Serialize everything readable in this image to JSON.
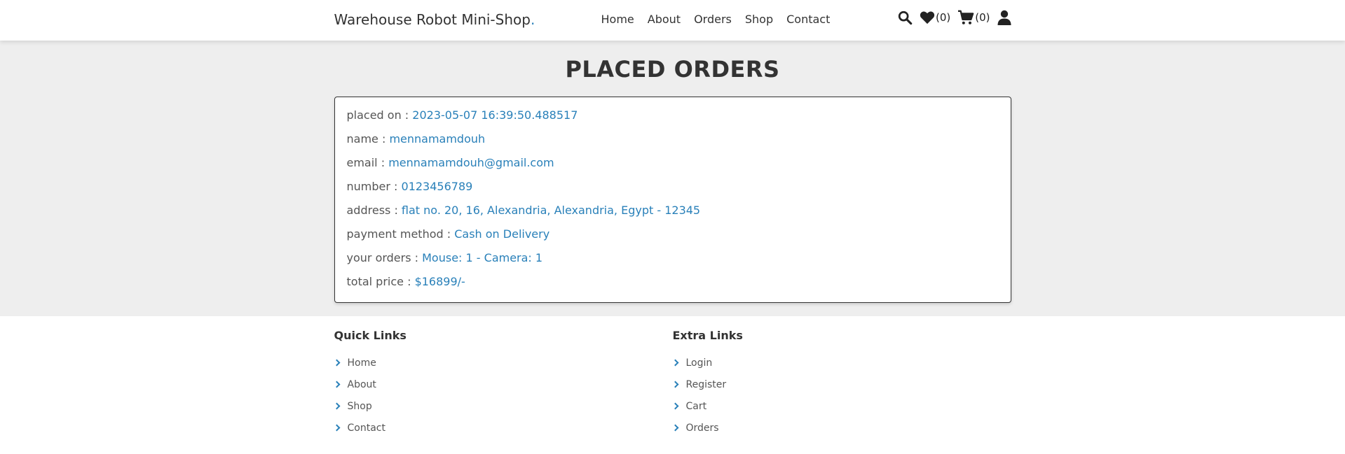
{
  "header": {
    "logo": "Warehouse Robot Mini-Shop",
    "logo_dot": ".",
    "nav": [
      {
        "label": "Home"
      },
      {
        "label": "About"
      },
      {
        "label": "Orders"
      },
      {
        "label": "Shop"
      },
      {
        "label": "Contact"
      }
    ],
    "wishlist_count": "(0)",
    "cart_count": "(0)",
    "icons": [
      "search-icon",
      "heart-icon",
      "cart-icon",
      "user-icon"
    ]
  },
  "main": {
    "title": "PLACED ORDERS",
    "order": {
      "placed_on_label": "placed on : ",
      "placed_on": "2023-05-07 16:39:50.488517",
      "name_label": "name : ",
      "name": "mennamamdouh",
      "email_label": "email : ",
      "email": "mennamamdouh@gmail.com",
      "number_label": "number : ",
      "number": "0123456789",
      "address_label": "address : ",
      "address": "flat no. 20, 16, Alexandria, Alexandria, Egypt - 12345",
      "payment_label": "payment method : ",
      "payment": "Cash on Delivery",
      "orders_label": "your orders : ",
      "orders": "Mouse: 1 - Camera: 1",
      "total_label": "total price : ",
      "total": "$16899/-"
    }
  },
  "footer": {
    "quick_links_title": "Quick Links",
    "quick_links": [
      {
        "label": "Home"
      },
      {
        "label": "About"
      },
      {
        "label": "Shop"
      },
      {
        "label": "Contact"
      }
    ],
    "extra_links_title": "Extra Links",
    "extra_links": [
      {
        "label": "Login"
      },
      {
        "label": "Register"
      },
      {
        "label": "Cart"
      },
      {
        "label": "Orders"
      }
    ]
  },
  "colors": {
    "accent": "#2980b9",
    "main_bg": "#eeeeee",
    "text": "#333333"
  }
}
